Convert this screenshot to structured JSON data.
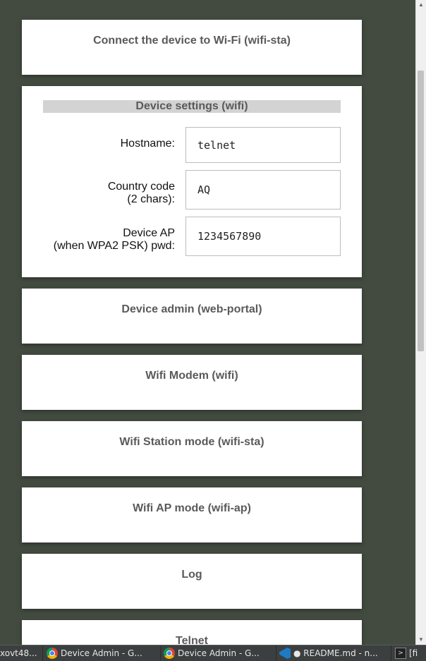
{
  "panels": {
    "connect_wifi": "Connect the device to Wi-Fi (wifi-sta)",
    "device_admin": "Device admin (web-portal)",
    "wifi_modem": "Wifi Modem (wifi)",
    "wifi_station": "Wifi Station mode (wifi-sta)",
    "wifi_ap": "Wifi AP mode (wifi-ap)",
    "log": "Log",
    "telnet": "Telnet"
  },
  "settings": {
    "header": "Device settings (wifi)",
    "hostname_label": "Hostname:",
    "hostname_value": "telnet",
    "country_label_line1": "Country code",
    "country_label_line2": "(2 chars):",
    "country_value": "AQ",
    "ap_pwd_label_line1": "Device AP",
    "ap_pwd_label_line2": "(when WPA2 PSK) pwd:",
    "ap_pwd_value": "1234567890"
  },
  "taskbar": {
    "items": [
      {
        "label": "xovt48...",
        "icon": "none"
      },
      {
        "label": "Device Admin - G...",
        "icon": "chrome-icon"
      },
      {
        "label": "Device Admin - G...",
        "icon": "chrome-icon"
      },
      {
        "label": "● README.md - n...",
        "icon": "vscode-icon"
      },
      {
        "label": "[fi",
        "icon": "terminal-icon"
      }
    ]
  }
}
